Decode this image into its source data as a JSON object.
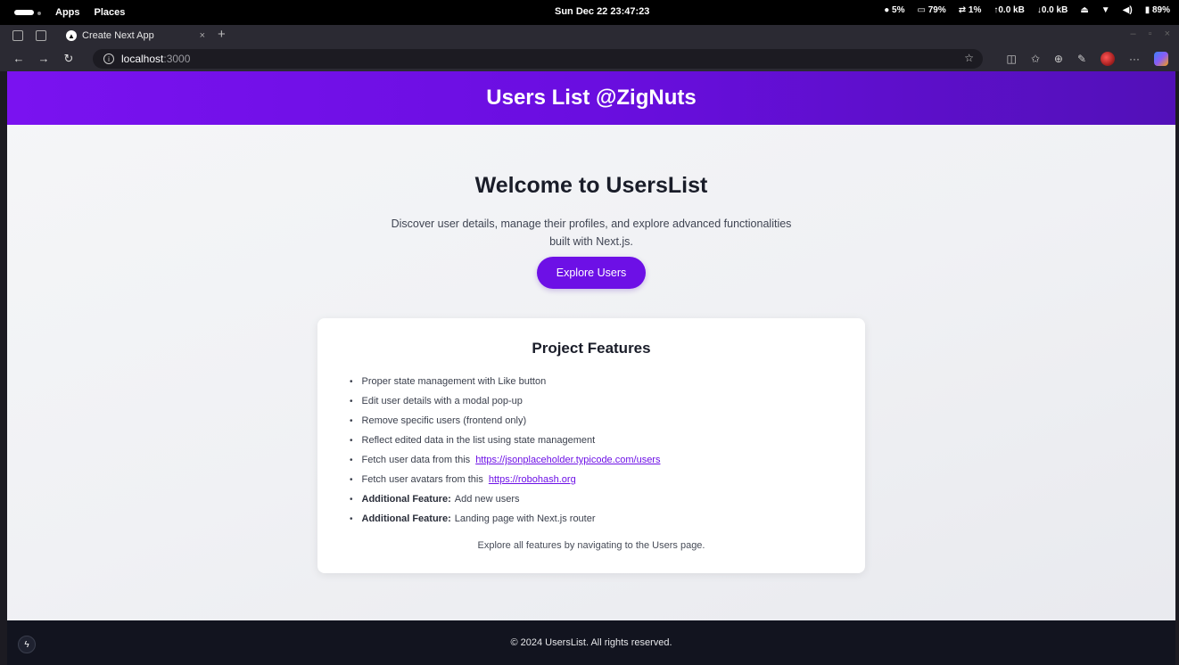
{
  "system": {
    "apps_label": "Apps",
    "places_label": "Places",
    "clock": "Sun Dec 22 23:47:23",
    "cpu": "5%",
    "mem": "79%",
    "swap": "1%",
    "net_up": "0.0 kB",
    "net_down": "0.0 kB",
    "battery": "89%"
  },
  "browser": {
    "tab_title": "Create Next App",
    "url_host": "localhost",
    "url_port": ":3000"
  },
  "page": {
    "header_title": "Users List @ZigNuts",
    "hero_title": "Welcome to UsersList",
    "hero_description": "Discover user details, manage their profiles, and explore advanced functionalities built with Next.js.",
    "cta_label": "Explore Users",
    "features_title": "Project Features",
    "features": [
      {
        "bold": "",
        "text": "Proper state management with Like button",
        "link": ""
      },
      {
        "bold": "",
        "text": "Edit user details with a modal pop-up",
        "link": ""
      },
      {
        "bold": "",
        "text": "Remove specific users (frontend only)",
        "link": ""
      },
      {
        "bold": "",
        "text": "Reflect edited data in the list using state management",
        "link": ""
      },
      {
        "bold": "",
        "text": "Fetch user data from this",
        "link": "https://jsonplaceholder.typicode.com/users"
      },
      {
        "bold": "",
        "text": "Fetch user avatars from this",
        "link": "https://robohash.org"
      },
      {
        "bold": "Additional Feature:",
        "text": "Add new users",
        "link": ""
      },
      {
        "bold": "Additional Feature:",
        "text": "Landing page with Next.js router",
        "link": ""
      }
    ],
    "features_footer": "Explore all features by navigating to the Users page.",
    "footer_text": "© 2024 UsersList. All rights reserved."
  },
  "colors": {
    "header_start": "#7a12f0",
    "header_end": "#5210b8",
    "accent": "#6d10e6",
    "footer_bg": "#12141f"
  }
}
